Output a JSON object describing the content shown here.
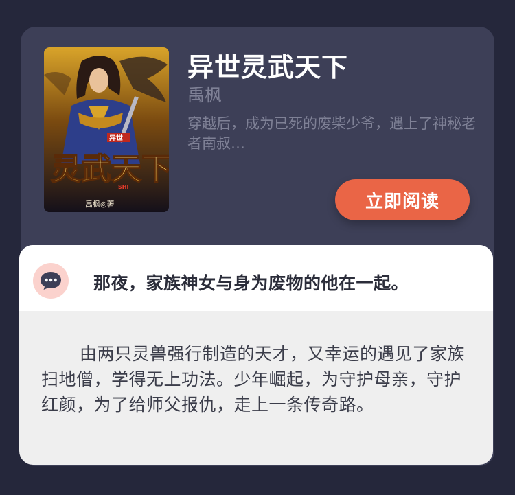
{
  "book": {
    "title": "异世灵武天下",
    "author": "禹枫",
    "summary": "穿越后，成为已死的废柴少爷，遇上了神秘老者南叔…",
    "cover": {
      "series_tag": "异世",
      "title_art": "灵武天下",
      "subtitle": "SHI",
      "author_line": "禹枫◎著"
    }
  },
  "actions": {
    "read_label": "立即阅读"
  },
  "comment": {
    "icon": "chat-bubble-icon",
    "headline": "那夜，家族神女与身为废物的他在一起。",
    "description": "由两只灵兽强行制造的天才，又幸运的遇见了家族扫地僧，学得无上功法。少年崛起，为守护母亲，守护红颜，为了给师父报仇，走上一条传奇路。"
  },
  "colors": {
    "background": "#25273b",
    "card": "#3d3f57",
    "accent": "#ea6546",
    "icon_bg": "#fbd2cd",
    "icon_fg": "#3d3f57"
  }
}
